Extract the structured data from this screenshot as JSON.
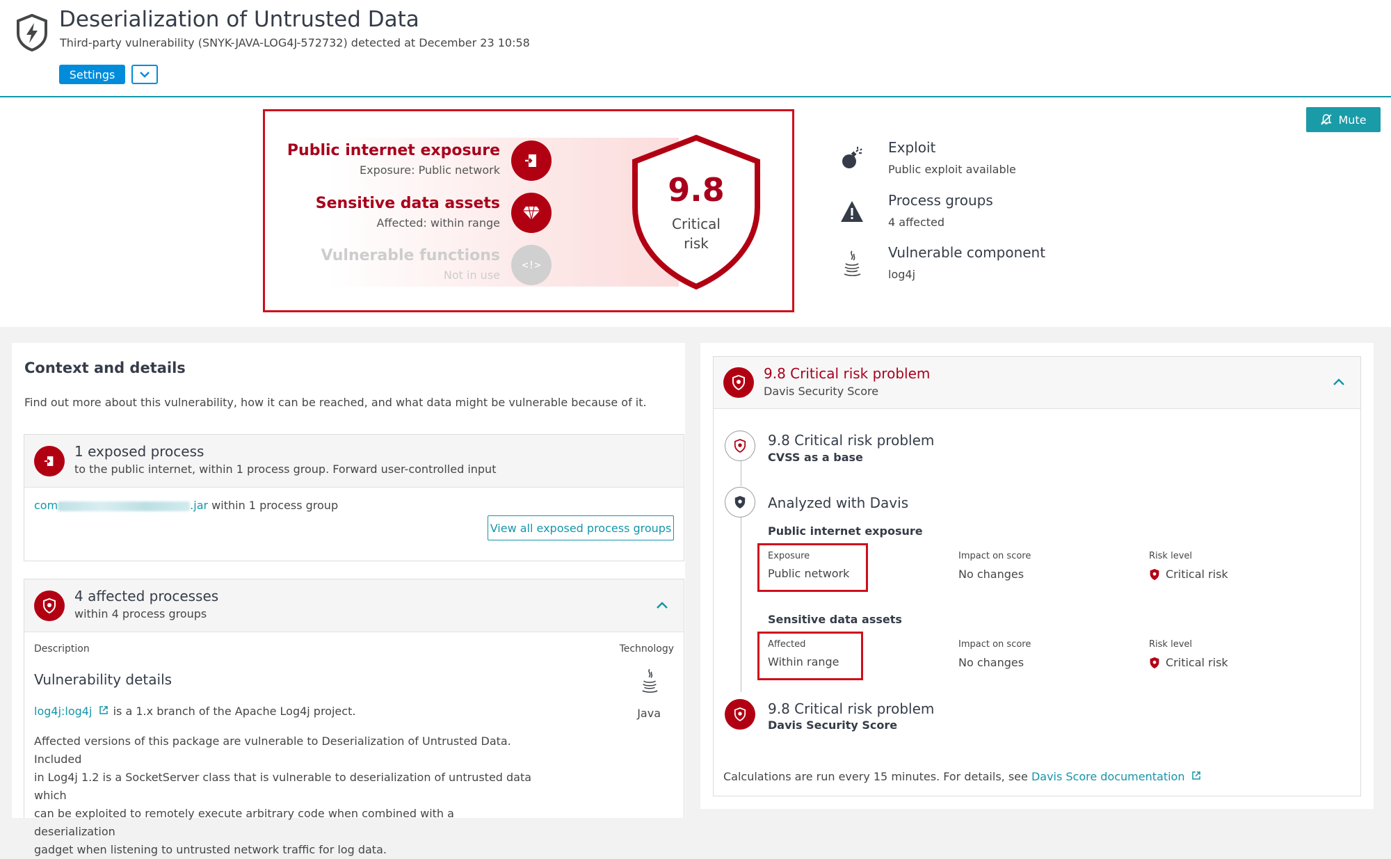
{
  "header": {
    "title": "Deserialization of Untrusted Data",
    "subtitle": "Third-party vulnerability (SNYK-JAVA-LOG4J-572732) detected at December 23 10:58",
    "settings_label": "Settings"
  },
  "mute_label": "Mute",
  "risk_factors": [
    {
      "title": "Public internet exposure",
      "sub": "Exposure: Public network"
    },
    {
      "title": "Sensitive data assets",
      "sub": "Affected: within range"
    },
    {
      "title": "Vulnerable functions",
      "sub": "Not in use"
    }
  ],
  "score": {
    "value": "9.8",
    "label_line1": "Critical",
    "label_line2": "risk"
  },
  "facts": [
    {
      "title": "Exploit",
      "sub": "Public exploit available",
      "icon": "bomb-icon"
    },
    {
      "title": "Process groups",
      "sub": "4 affected",
      "icon": "warning-icon"
    },
    {
      "title": "Vulnerable component",
      "sub": "log4j",
      "icon": "java-icon"
    }
  ],
  "context": {
    "title": "Context and details",
    "desc": "Find out more about this vulnerability, how it can be reached, and what data might be vulnerable because of it.",
    "exposed": {
      "title": "1 exposed process",
      "sub": "to the public internet, within 1 process group. Forward user-controlled input",
      "link_prefix": "com",
      "link_suffix": ".jar",
      "link_tail": " within 1 process group",
      "button": "View all exposed process groups"
    },
    "affected": {
      "title": "4 affected processes",
      "sub": "within 4 process groups",
      "col_description": "Description",
      "col_technology": "Technology",
      "vuln_title": "Vulnerability details",
      "pkg_link": "log4j:log4j",
      "pkg_text": " is a 1.x branch of the Apache Log4j project.",
      "tech": "Java",
      "para": [
        "Affected versions of this package are vulnerable to Deserialization of Untrusted Data. Included",
        "in Log4j 1.2 is a SocketServer class that is vulnerable to deserialization of untrusted data which",
        "can be exploited to remotely execute arbitrary code when combined with a deserialization",
        "gadget when listening to untrusted network traffic for log data."
      ]
    }
  },
  "davis": {
    "head_title": "9.8 Critical risk problem",
    "head_sub": "Davis Security Score",
    "step1_title": "9.8 Critical risk problem",
    "step1_sub": "CVSS as a base",
    "step2_title": "Analyzed with Davis",
    "exposure_section": "Public internet exposure",
    "exposure_label": "Exposure",
    "exposure_value": "Public network",
    "impact_label": "Impact on score",
    "impact_value": "No changes",
    "risk_label": "Risk level",
    "risk_value": "Critical risk",
    "sensitive_section": "Sensitive data assets",
    "affected_label": "Affected",
    "affected_value": "Within range",
    "impact_label2": "Impact on score",
    "impact_value2": "No changes",
    "risk_label2": "Risk level",
    "risk_value2": "Critical risk",
    "step3_title": "9.8 Critical risk problem",
    "step3_sub": "Davis Security Score",
    "footer_text": "Calculations are run every 15 minutes. For details, see ",
    "footer_link": "Davis Score documentation"
  },
  "colors": {
    "accent": "#1496a8",
    "critical": "#b20013",
    "button": "#008cdb"
  }
}
